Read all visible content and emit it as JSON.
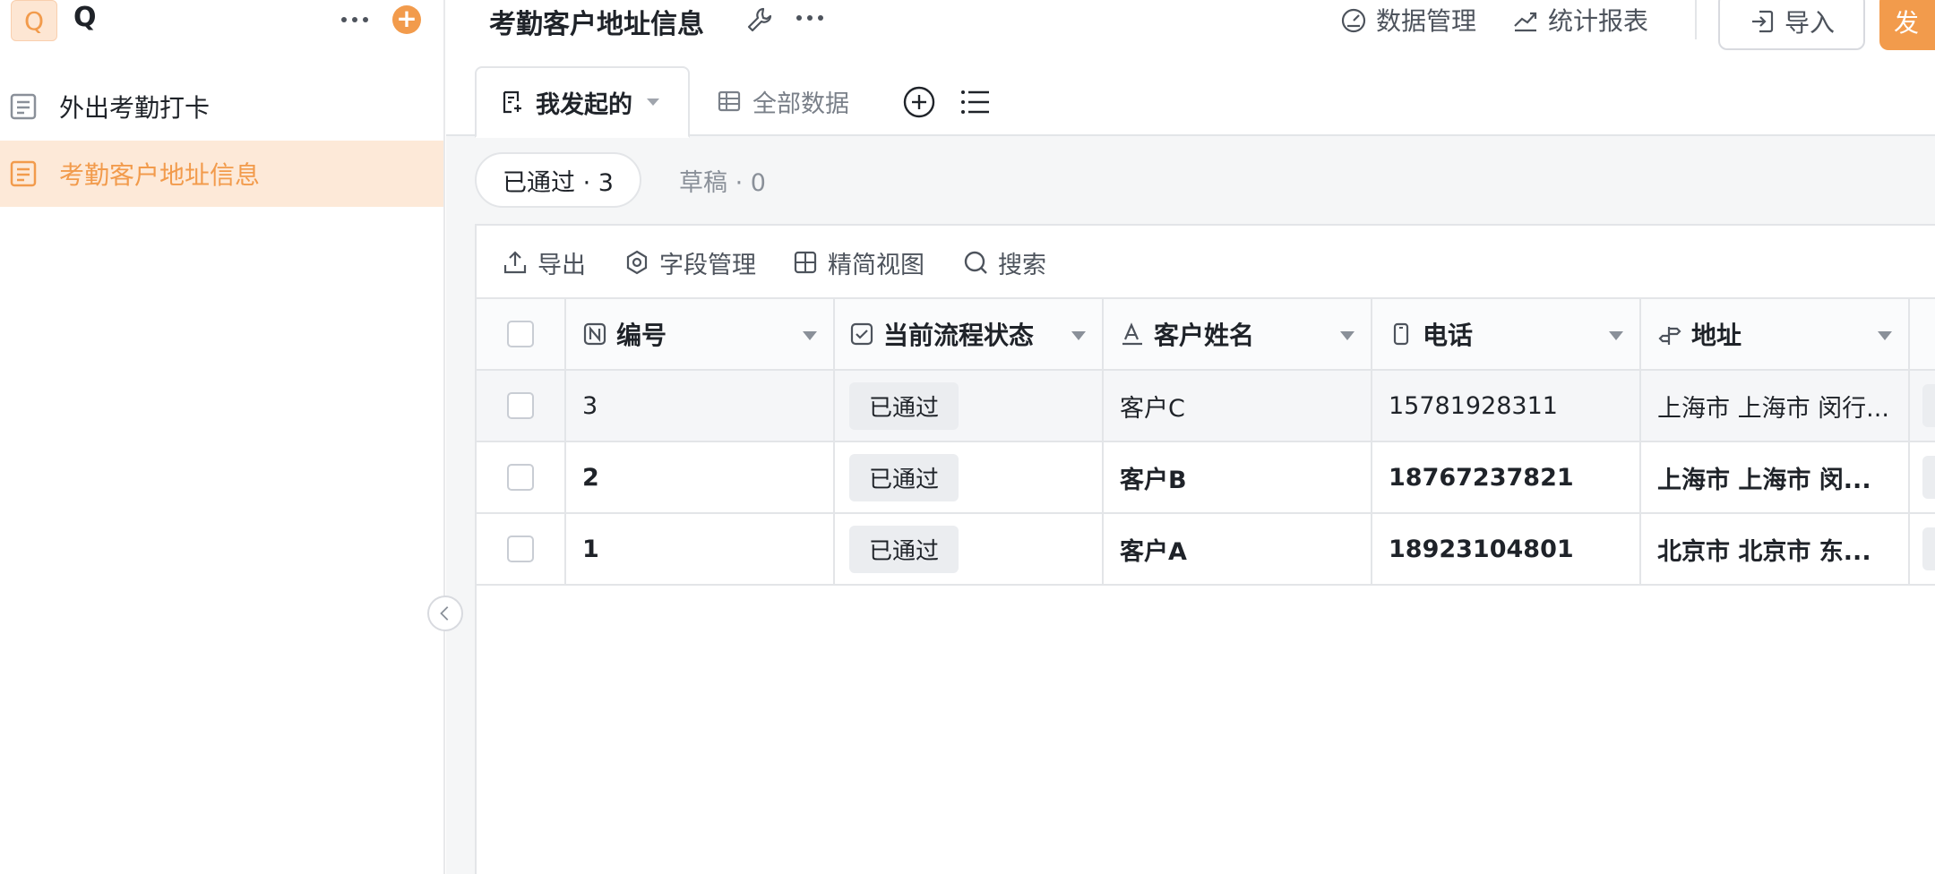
{
  "app": {
    "avatar": "Q",
    "name": "Q",
    "add_icon": "plus-icon",
    "more_icon": "more-icon"
  },
  "sidebar": {
    "items": [
      {
        "label": "外出考勤打卡",
        "icon": "form-icon",
        "active": false
      },
      {
        "label": "考勤客户地址信息",
        "icon": "form-icon",
        "active": true
      }
    ]
  },
  "header": {
    "title": "考勤客户地址信息",
    "data_manage": "数据管理",
    "stats_report": "统计报表",
    "import": "导入",
    "publish": "发"
  },
  "tabs": [
    {
      "label": "我发起的",
      "active": true
    },
    {
      "label": "全部数据",
      "active": false
    }
  ],
  "status_filters": {
    "approved": "已通过 · 3",
    "draft": "草稿 · 0"
  },
  "toolbar": {
    "export": "导出",
    "field_manage": "字段管理",
    "compact_view": "精简视图",
    "search": "搜索"
  },
  "table": {
    "columns": [
      "编号",
      "当前流程状态",
      "客户姓名",
      "电话",
      "地址"
    ],
    "rows": [
      {
        "id": "3",
        "status": "已通过",
        "name": "客户C",
        "phone": "15781928311",
        "address": "上海市 上海市 闵行..."
      },
      {
        "id": "2",
        "status": "已通过",
        "name": "客户B",
        "phone": "18767237821",
        "address": "上海市 上海市 闵..."
      },
      {
        "id": "1",
        "status": "已通过",
        "name": "客户A",
        "phone": "18923104801",
        "address": "北京市 北京市 东..."
      }
    ]
  },
  "colors": {
    "accent": "#f29b4c",
    "active_bg": "#fde9d8",
    "border": "#e3e5e8"
  }
}
